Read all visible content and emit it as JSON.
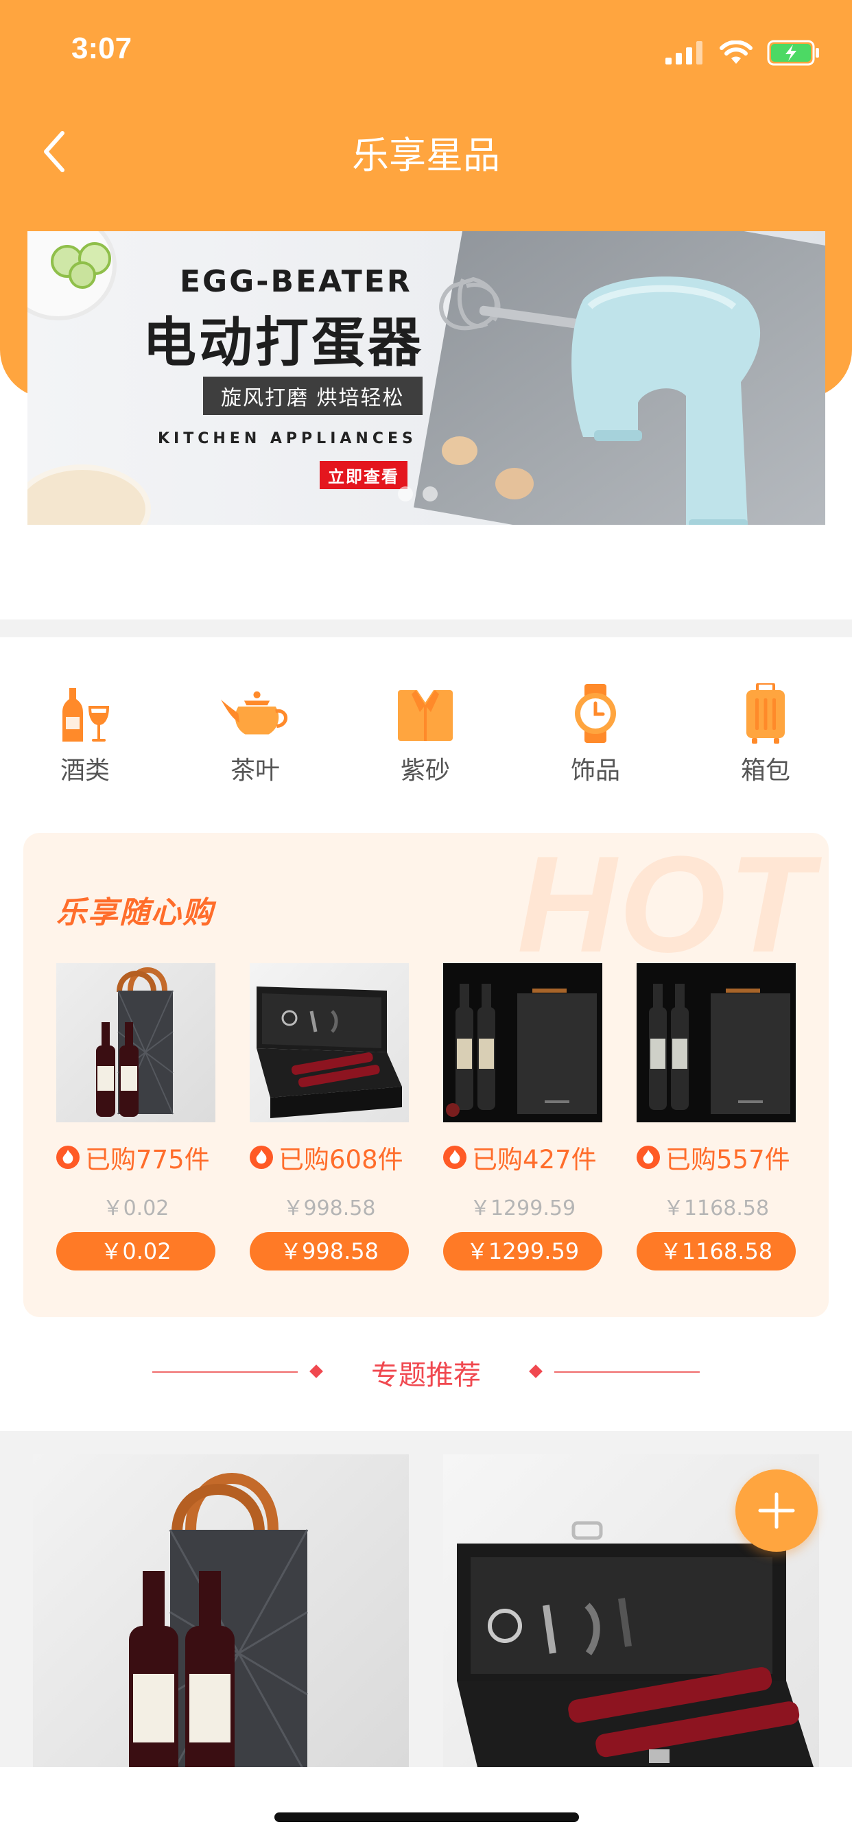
{
  "status_bar": {
    "time": "3:07"
  },
  "nav": {
    "title": "乐享星品"
  },
  "banner": {
    "title_en": "EGG-BEATER",
    "title_cn": "电动打蛋器",
    "tagline": "旋风打磨 烘培轻松",
    "subtitle": "KITCHEN APPLIANCES",
    "cta": "立即查看",
    "page_count": 2,
    "active_page": 1
  },
  "categories": [
    {
      "label": "酒类",
      "icon": "wine-icon"
    },
    {
      "label": "茶叶",
      "icon": "teapot-icon"
    },
    {
      "label": "紫砂",
      "icon": "shirt-icon"
    },
    {
      "label": "饰品",
      "icon": "watch-icon"
    },
    {
      "label": "箱包",
      "icon": "suitcase-icon"
    }
  ],
  "hot": {
    "watermark": "HOT",
    "title": "乐享随心购",
    "products": [
      {
        "sold": "已购775件",
        "original_price": "￥0.02",
        "price": "￥0.02"
      },
      {
        "sold": "已购608件",
        "original_price": "￥998.58",
        "price": "￥998.58"
      },
      {
        "sold": "已购427件",
        "original_price": "￥1299.59",
        "price": "￥1299.59"
      },
      {
        "sold": "已购557件",
        "original_price": "￥1168.58",
        "price": "￥1168.58"
      }
    ]
  },
  "section": {
    "title": "专题推荐"
  },
  "colors": {
    "brand_orange": "#ffa53f",
    "price_orange": "#ff7a26",
    "accent_red": "#f0484f",
    "hot_bg": "#fff4ea"
  }
}
